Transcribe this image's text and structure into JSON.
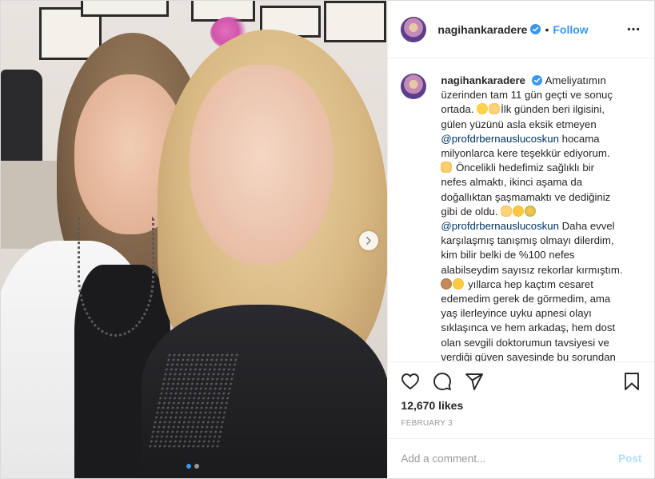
{
  "photo": {
    "carousel_dots": [
      true,
      false
    ]
  },
  "header": {
    "username": "nagihankaradere",
    "separator": "•",
    "follow_label": "Follow",
    "more_icon": "more-horizontal-icon"
  },
  "caption": {
    "username": "nagihankaradere",
    "segments": {
      "s1": "Ameliyatımın",
      "s2": "üzerinden tam 11 gün geçti ve sonuç",
      "s3": "ortada.",
      "s4": "İlk günden beri ilgisini,",
      "s5": "gülen yüzünü asla eksik etmeyen",
      "m1": "@profdrbernauslucoskun",
      "s6": "hocama",
      "s7": "milyonlarca kere teşekkür ediyorum.",
      "s8": "Öncelikli hedefimiz sağlıklı bir",
      "s9": "nefes almaktı, ikinci aşama da",
      "s10": "doğallıktan şaşmamaktı ve dediğiniz",
      "s11": "gibi de oldu.",
      "m2": "@profdrbernauslucoskun",
      "s12": "Daha evvel",
      "s13": "karşılaşmış tanışmış olmayı dilerdim,",
      "s14": "kim bilir belki de %100 nefes",
      "s15": "alabilseydim sayısız rekorlar kırmıştım.",
      "s16": "yıllarca hep kaçtım cesaret",
      "s17": "edemedim gerek de görmedim, ama",
      "s18": "yaş ilerleyince uyku apnesi olayı",
      "s19": "sıklaşınca ve hem arkadaş, hem dost",
      "s20": "olan sevgili doktorumun tavsiyesi ve",
      "s21": "verdiği güven sayesinde bu sorundan"
    },
    "emoji_names": [
      "star-struck-emoji",
      "ok-hand-emoji",
      "folded-hands-emoji",
      "ok-hand-emoji",
      "smiling-face-emoji",
      "bouquet-emoji",
      "see-no-evil-monkey-emoji",
      "upside-down-face-emoji"
    ]
  },
  "actions": {
    "like_icon": "heart-icon",
    "comment_icon": "comment-icon",
    "share_icon": "share-icon",
    "save_icon": "bookmark-icon",
    "likes_text": "12,670 likes",
    "date_text": "February 3"
  },
  "comment": {
    "placeholder": "Add a comment...",
    "post_label": "Post"
  },
  "colors": {
    "link": "#3897f0",
    "mention": "#003569",
    "verified": "#3897f0",
    "post_disabled": "#b2dffc"
  }
}
